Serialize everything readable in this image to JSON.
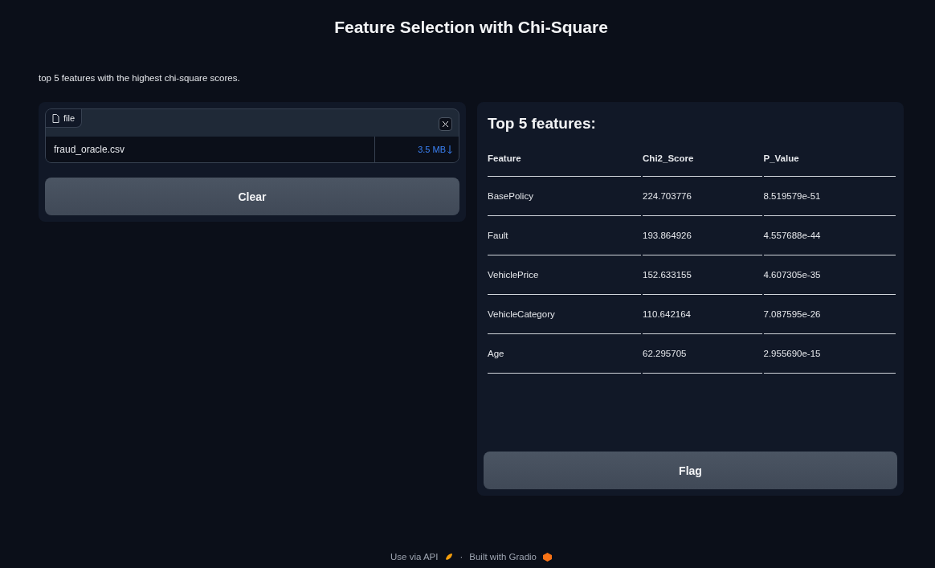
{
  "title": "Feature Selection with Chi-Square",
  "description": "top 5 features with the highest chi-square scores.",
  "file_input": {
    "label": "file",
    "file_name": "fraud_oracle.csv",
    "file_size": "3.5 MB"
  },
  "clear_button": "Clear",
  "output": {
    "heading": "Top 5 features:",
    "columns": [
      "Feature",
      "Chi2_Score",
      "P_Value"
    ],
    "rows": [
      [
        "BasePolicy",
        "224.703776",
        "8.519579e-51"
      ],
      [
        "Fault",
        "193.864926",
        "4.557688e-44"
      ],
      [
        "VehiclePrice",
        "152.633155",
        "4.607305e-35"
      ],
      [
        "VehicleCategory",
        "110.642164",
        "7.087595e-26"
      ],
      [
        "Age",
        "62.295705",
        "2.955690e-15"
      ]
    ]
  },
  "flag_button": "Flag",
  "footer": {
    "api_link": "Use via API",
    "separator": "·",
    "built_with": "Built with Gradio"
  }
}
